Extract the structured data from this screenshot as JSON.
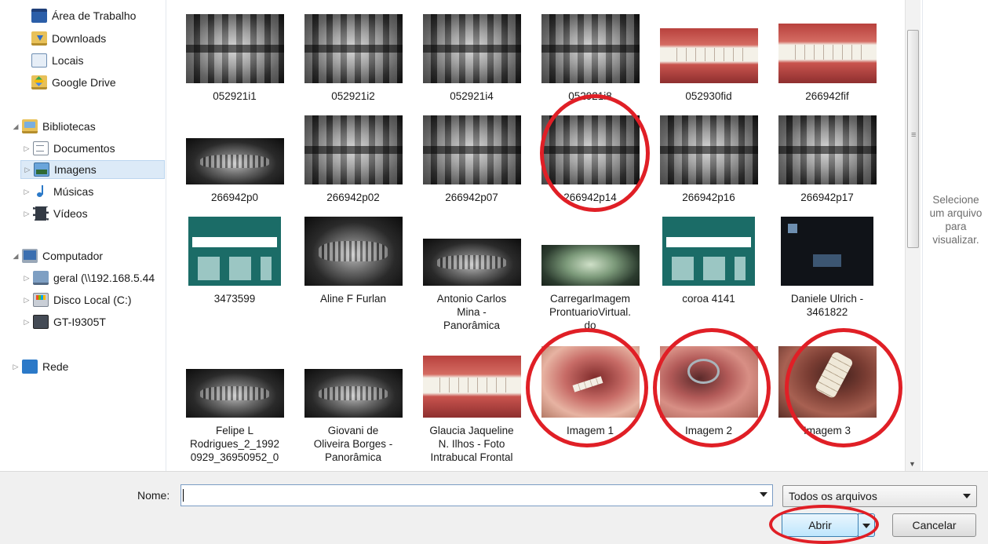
{
  "nav": {
    "favorites": [
      {
        "label": "Área de Trabalho",
        "icon": "desktop-icon"
      },
      {
        "label": "Downloads",
        "icon": "downloads-folder-icon"
      },
      {
        "label": "Locais",
        "icon": "places-icon"
      },
      {
        "label": "Google Drive",
        "icon": "google-drive-icon"
      }
    ],
    "libraries": {
      "label": "Bibliotecas",
      "icon": "libraries-icon"
    },
    "library_items": [
      {
        "label": "Documentos",
        "icon": "documents-icon"
      },
      {
        "label": "Imagens",
        "icon": "pictures-icon",
        "selected": true
      },
      {
        "label": "Músicas",
        "icon": "music-icon"
      },
      {
        "label": "Vídeos",
        "icon": "videos-icon"
      }
    ],
    "computer": {
      "label": "Computador",
      "icon": "computer-icon"
    },
    "computer_items": [
      {
        "label": "geral (\\\\192.168.5.44",
        "icon": "network-drive-icon"
      },
      {
        "label": "Disco Local (C:)",
        "icon": "local-disk-icon"
      },
      {
        "label": "GT-I9305T",
        "icon": "phone-icon"
      }
    ],
    "network": {
      "label": "Rede",
      "icon": "network-icon"
    }
  },
  "files": [
    {
      "name": "052921i1",
      "kind": "xray"
    },
    {
      "name": "052921i2",
      "kind": "xray"
    },
    {
      "name": "052921i4",
      "kind": "xray"
    },
    {
      "name": "052921i8",
      "kind": "xray"
    },
    {
      "name": "052930fid",
      "kind": "teeth"
    },
    {
      "name": "266942fif",
      "kind": "teeth"
    },
    {
      "name": "266942p0",
      "kind": "pano"
    },
    {
      "name": "266942p02",
      "kind": "xray"
    },
    {
      "name": "266942p07",
      "kind": "xray"
    },
    {
      "name": "266942p14",
      "kind": "xray"
    },
    {
      "name": "266942p16",
      "kind": "xray"
    },
    {
      "name": "266942p17",
      "kind": "xray"
    },
    {
      "name": "3473599",
      "kind": "doc"
    },
    {
      "name": "Aline F Furlan",
      "kind": "pano"
    },
    {
      "name": "Antonio Carlos\nMina -\nPanorâmica",
      "kind": "pano"
    },
    {
      "name": "CarregarImagem\nProntuarioVirtual.\ndo",
      "kind": "greenpano"
    },
    {
      "name": "coroa 4141",
      "kind": "doc"
    },
    {
      "name": "Daniele Ulrich -\n3461822",
      "kind": "darkdoc"
    },
    {
      "name": "Felipe L\nRodrigues_2_1992\n0929_36950952_0",
      "kind": "pano"
    },
    {
      "name": "Giovani de\nOliveira Borges -\nPanorâmica",
      "kind": "pano"
    },
    {
      "name": "Glaucia Jaqueline\nN. Ilhos - Foto\nIntrabucal Frontal",
      "kind": "teeth"
    },
    {
      "name": "Imagem 1",
      "kind": "mouth"
    },
    {
      "name": "Imagem 2",
      "kind": "mouth2"
    },
    {
      "name": "Imagem 3",
      "kind": "mouth3"
    }
  ],
  "highlight_color": "#e01f26",
  "preview_text": "Selecione\num arquivo\npara\nvisualizar.",
  "footer": {
    "name_label": "Nome:",
    "name_value": "",
    "file_type": "Todos os arquivos",
    "open_label": "Abrir",
    "cancel_label": "Cancelar"
  }
}
